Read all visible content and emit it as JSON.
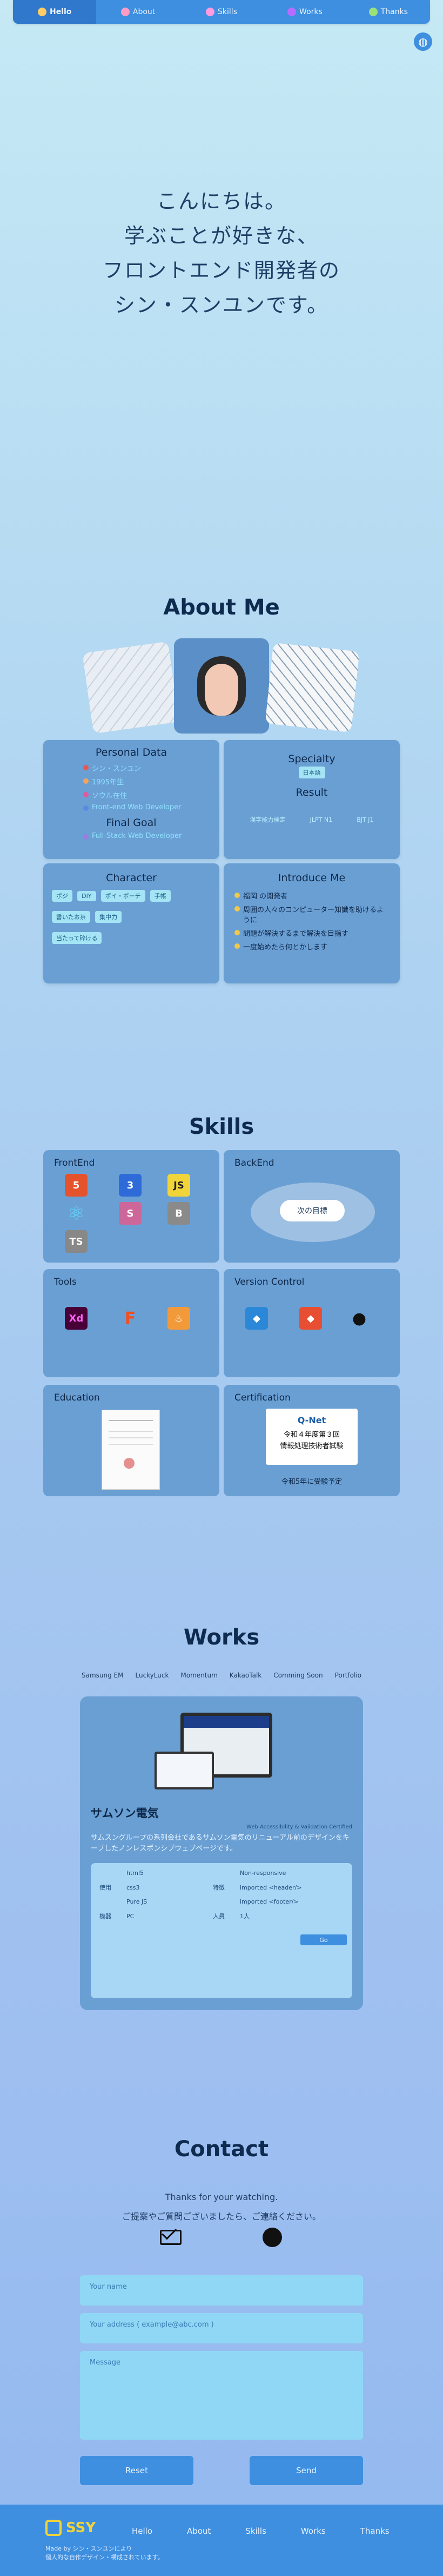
{
  "nav": {
    "items": [
      {
        "label": "Hello",
        "icon": "hello-icon",
        "color": "#ffcc66"
      },
      {
        "label": "About",
        "icon": "about-icon",
        "color": "#ff9cc6"
      },
      {
        "label": "Skills",
        "icon": "skills-icon",
        "color": "#ff9ce0"
      },
      {
        "label": "Works",
        "icon": "works-icon",
        "color": "#b86bff"
      },
      {
        "label": "Thanks",
        "icon": "thanks-icon",
        "color": "#9ce07a"
      }
    ]
  },
  "hero": {
    "lines": [
      "こんにちは。",
      "学ぶことが好きな、",
      "フロントエンド開発者の",
      "シン・スンユンです。"
    ]
  },
  "about": {
    "title": "About Me",
    "personal_data": {
      "title": "Personal Data",
      "items": [
        "シン・スンユン",
        "1995年生",
        "ソウル在住",
        "Front-end Web Developer"
      ]
    },
    "final_goal": {
      "title": "Final Goal",
      "text": "Full-Stack Web Developer"
    },
    "specialty": {
      "title": "Specialty",
      "tag": "日本語"
    },
    "result": {
      "title": "Result",
      "items": [
        "漢字能力検定",
        "JLPT N1",
        "BJT J1"
      ]
    },
    "character": {
      "title": "Character",
      "tags": [
        "ポジ",
        "DIY",
        "ポイ・ポーチ",
        "手帳",
        "書いたお茶",
        "集中力",
        "当たって砕ける"
      ]
    },
    "introduce": {
      "title": "Introduce Me",
      "items": [
        "福岡 の開発者",
        "周囲の人々のコンピューター知識を助けるように",
        "問題が解決するまで解決を目指す",
        "一度始めたら何とかします"
      ]
    }
  },
  "skills": {
    "title": "Skills",
    "frontend": "FrontEnd",
    "backend": "BackEnd",
    "backend_button": "次の目標",
    "tools": "Tools",
    "version_control": "Version Control",
    "education": "Education",
    "certification": "Certification",
    "cert_line1": "令和４年度第３回",
    "cert_line2": "情報処理技術者試験",
    "cert_caption": "令和5年に受験予定",
    "icons": {
      "html": "5",
      "css": "3",
      "js": "JS",
      "react": "⚛",
      "sass": "S",
      "bootstrap": "B",
      "ts": "TS",
      "xd": "Xd",
      "figma": "F",
      "fire": "♨",
      "sourcetree": "◆",
      "git": "◆",
      "github": "●"
    }
  },
  "works": {
    "title": "Works",
    "tabs": [
      "Samsung EM",
      "LuckyLuck",
      "Momentum",
      "KakaoTalk",
      "Comming Soon",
      "Portfolio"
    ],
    "project": {
      "name": "サムソン電気",
      "tagline": "Web Accessibility & Validation Certified",
      "description": "サムスングループの系列会社であるサムソン電気のリニューアル前のデザインをキープしたノンレスポンシブウェブページです。",
      "rows": [
        [
          "",
          "html5",
          "",
          "Non-responsive"
        ],
        [
          "使用",
          "css3",
          "特徴",
          "imported <header/>"
        ],
        [
          "",
          "Pure JS",
          "",
          "imported <footer/>"
        ],
        [
          "機器",
          "PC",
          "人員",
          "1人"
        ]
      ],
      "go_label": "Go"
    }
  },
  "contact": {
    "title": "Contact",
    "line1": "Thanks for your watching.",
    "line2": "ご提案やご質問ございましたら、ご連絡ください。",
    "name_placeholder": "Your name",
    "email_placeholder": "Your address ( example@abc.com )",
    "message_placeholder": "Message",
    "reset_label": "Reset",
    "send_label": "Send"
  },
  "footer": {
    "logo": "SSY",
    "nav": [
      "Hello",
      "About",
      "Skills",
      "Works",
      "Thanks"
    ],
    "line1": "Made by シン・スンユンにより",
    "line2": "個人的な自作デザイン・構成されています。"
  },
  "colors": {
    "accent": "#3e8fe0",
    "card": "#6a9fd4",
    "tag": "#a5e4f5",
    "dark": "#0e2a4e"
  }
}
